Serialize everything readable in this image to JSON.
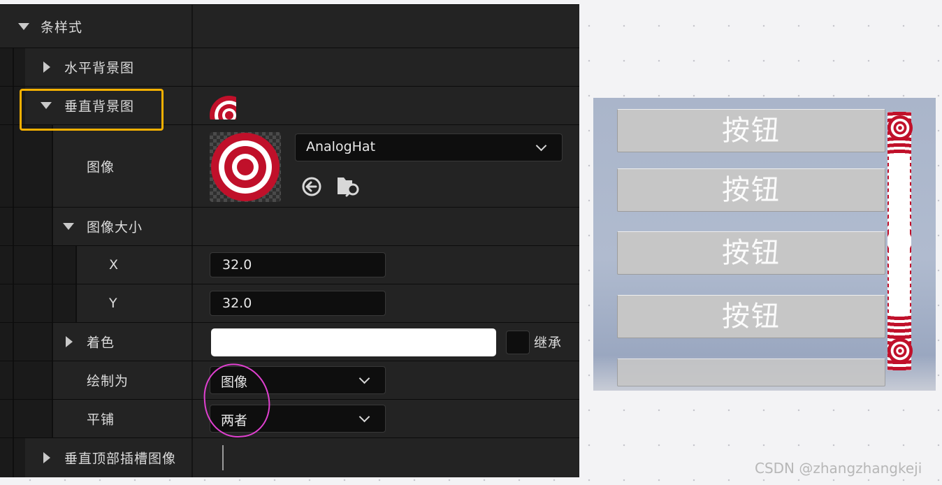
{
  "details": {
    "bar_style": {
      "label": "条样式"
    },
    "horizontal_bg": {
      "label": "水平背景图"
    },
    "vertical_bg": {
      "label": "垂直背景图"
    },
    "image": {
      "label": "图像",
      "asset_name": "AnalogHat"
    },
    "image_size": {
      "label": "图像大小",
      "x_label": "X",
      "x_value": "32.0",
      "y_label": "Y",
      "y_value": "32.0"
    },
    "tint": {
      "label": "着色",
      "inherit_label": "继承",
      "color": "#ffffff"
    },
    "draw_as": {
      "label": "绘制为",
      "value": "图像"
    },
    "tiling": {
      "label": "平铺",
      "value": "两者"
    },
    "vertical_top_slot": {
      "label": "垂直顶部插槽图像"
    }
  },
  "preview": {
    "buttons": [
      "按钮",
      "按钮",
      "按钮",
      "按钮"
    ]
  },
  "watermark": "CSDN @zhangzhangkeji",
  "colors": {
    "panel_bg": "#232323",
    "highlight_box": "#f5b000",
    "annotation_circle": "#e040d0",
    "target_red": "#c0102a"
  }
}
